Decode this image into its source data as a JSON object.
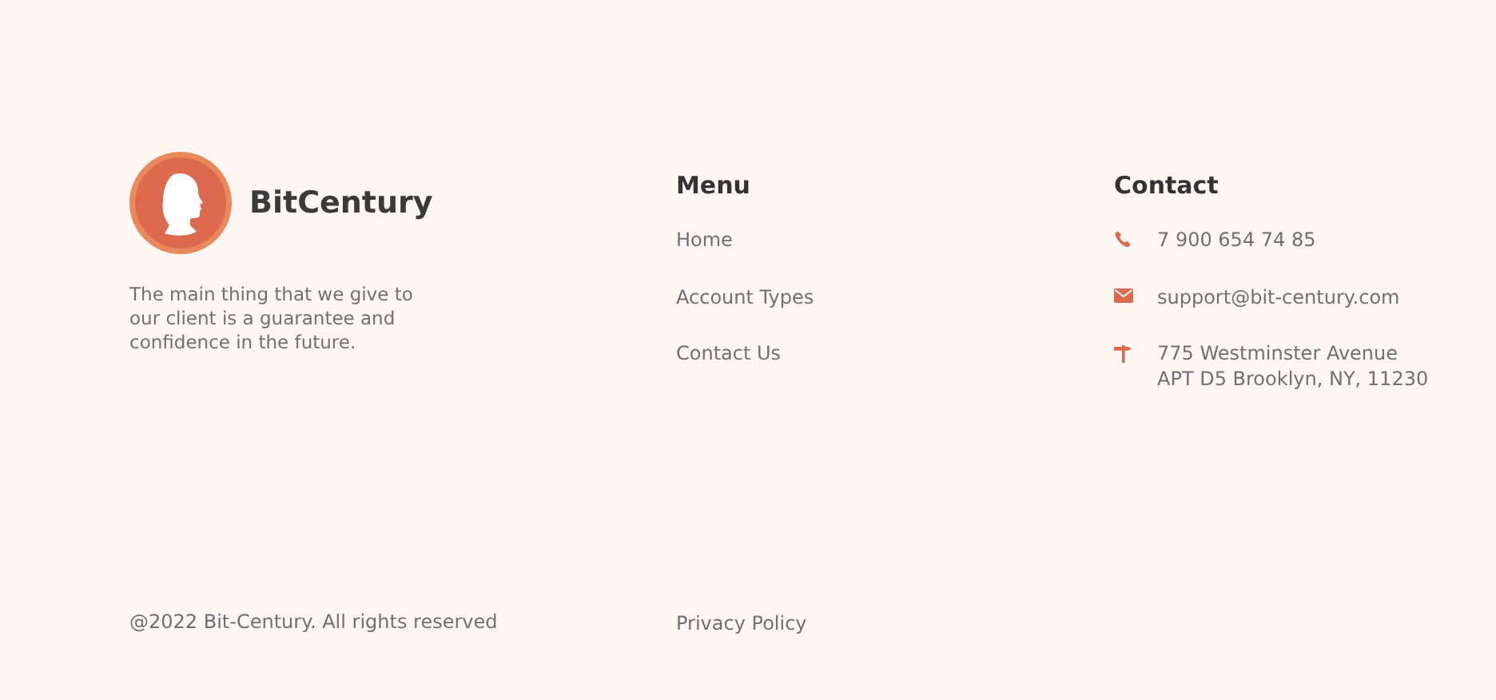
{
  "brand": {
    "name": "BitCentury",
    "tagline": "The main thing that we give to our client is a guarantee and confidence in the future."
  },
  "menu": {
    "title": "Menu",
    "items": [
      {
        "label": "Home"
      },
      {
        "label": "Account Types"
      },
      {
        "label": "Contact Us"
      }
    ]
  },
  "contact": {
    "title": "Contact",
    "items": [
      {
        "kind": "phone",
        "lines": [
          "7 900 654 74 85"
        ]
      },
      {
        "kind": "email",
        "lines": [
          "support@bit-century.com"
        ]
      },
      {
        "kind": "address",
        "lines": [
          "775 Westminster Avenue",
          "APT D5 Brooklyn, NY, 11230"
        ]
      }
    ]
  },
  "footer": {
    "copyright": "@2022 Bit-Century. All rights reserved",
    "links": [
      {
        "label": "Privacy Policy"
      }
    ]
  }
}
